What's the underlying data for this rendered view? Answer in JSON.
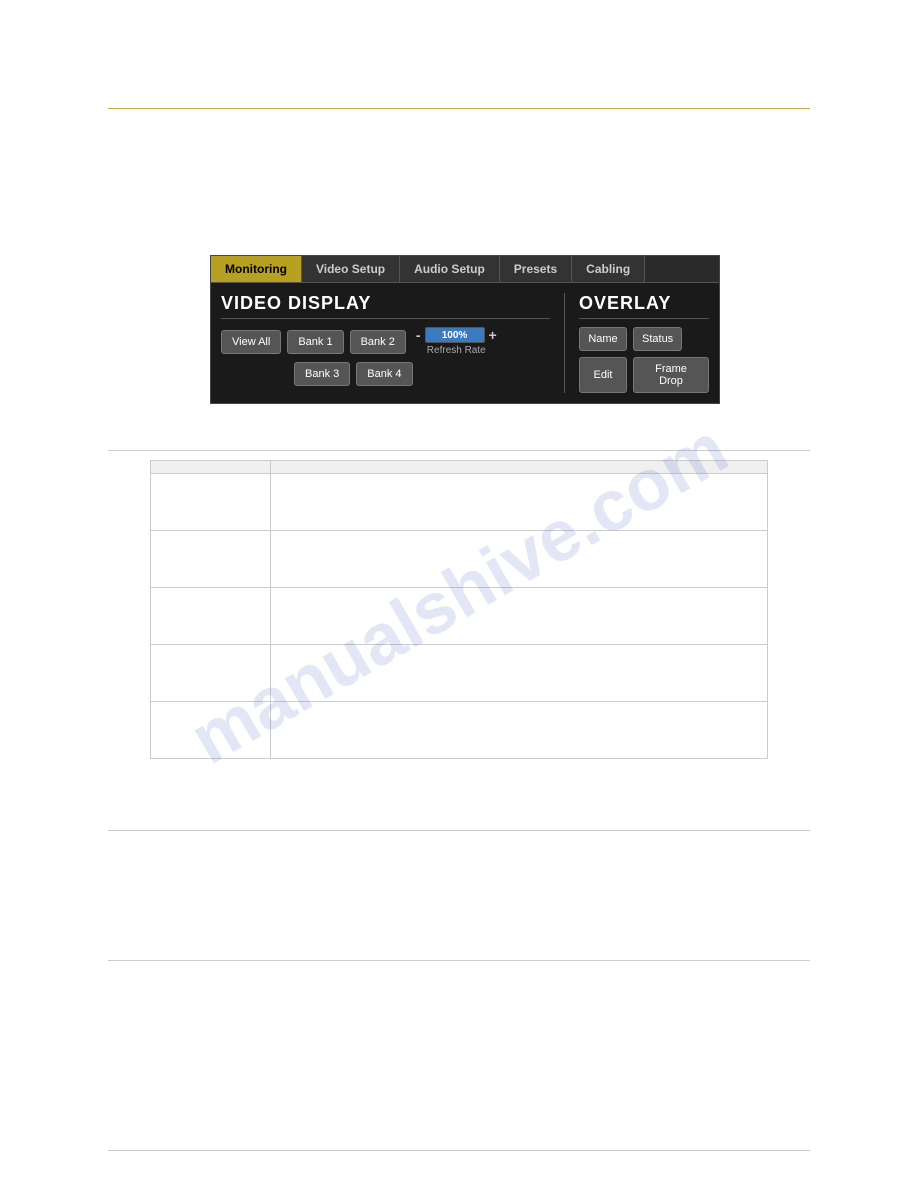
{
  "watermark": {
    "text": "manualshive.com"
  },
  "tabs": [
    {
      "label": "Monitoring",
      "active": true
    },
    {
      "label": "Video Setup",
      "active": false
    },
    {
      "label": "Audio Setup",
      "active": false
    },
    {
      "label": "Presets",
      "active": false
    },
    {
      "label": "Cabling",
      "active": false
    }
  ],
  "video_display": {
    "title": "VIDEO DISPLAY",
    "view_all": "View All",
    "bank1": "Bank 1",
    "bank2": "Bank 2",
    "bank3": "Bank 3",
    "bank4": "Bank 4",
    "minus": "-",
    "plus": "+",
    "refresh_pct": "100%",
    "refresh_label": "Refresh Rate"
  },
  "overlay": {
    "title": "OVERLAY",
    "name": "Name",
    "status": "Status",
    "edit": "Edit",
    "frame_drop": "Frame Drop"
  },
  "table": {
    "col1_header": "",
    "col2_header": "",
    "rows": [
      {
        "label": "",
        "desc": ""
      },
      {
        "label": "",
        "desc": ""
      },
      {
        "label": "",
        "desc": ""
      },
      {
        "label": "",
        "desc": ""
      },
      {
        "label": "",
        "desc": ""
      }
    ]
  }
}
